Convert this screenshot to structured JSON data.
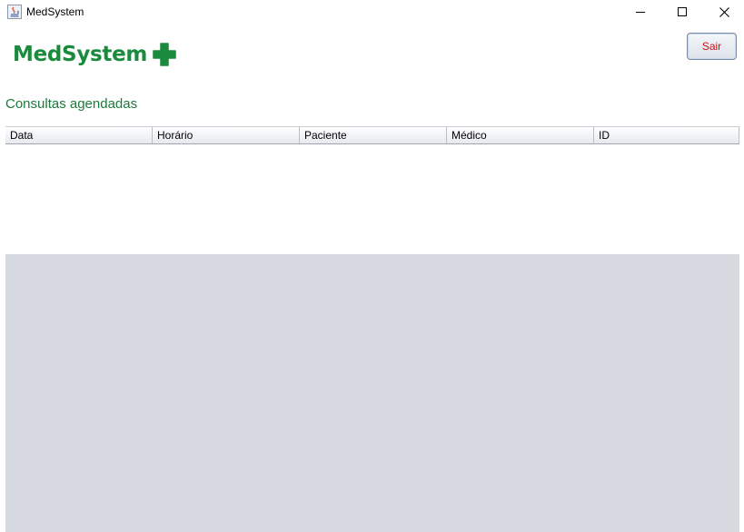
{
  "window": {
    "title": "MedSystem"
  },
  "header": {
    "logo_text": "MedSystem",
    "logo_color": "#1a8a3c",
    "exit_label": "Sair",
    "exit_color": "#c81414"
  },
  "section": {
    "title": "Consultas agendadas"
  },
  "table": {
    "columns": [
      "Data",
      "Horário",
      "Paciente",
      "Médico",
      "ID"
    ],
    "rows": []
  }
}
